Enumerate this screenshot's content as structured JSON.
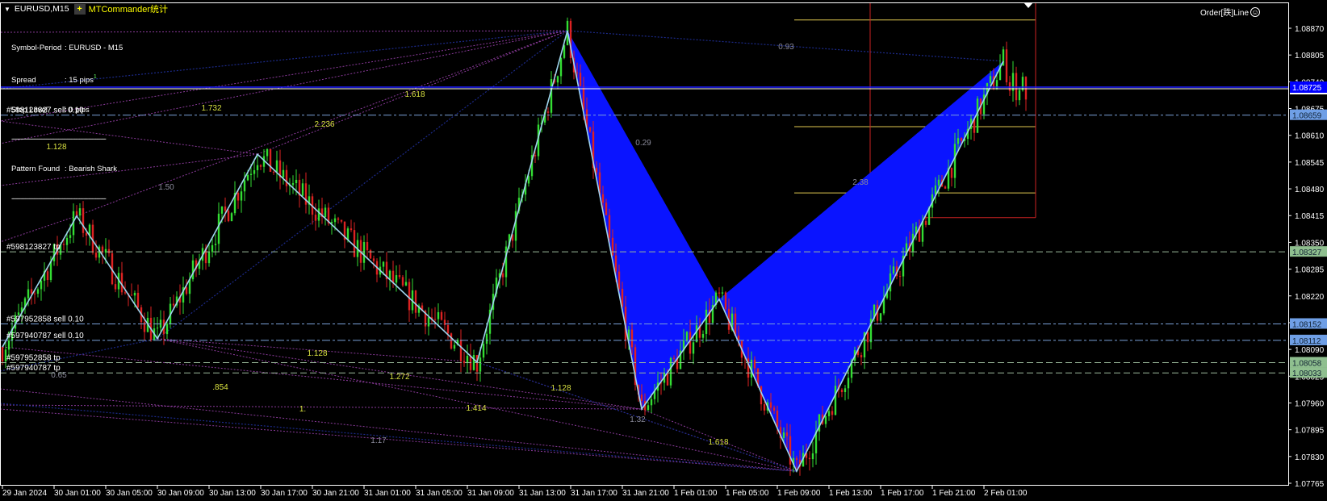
{
  "window": {
    "symbol_title": "EURUSD,M15",
    "add_button": "+",
    "indicator_title": "MTCommander统计",
    "order_line_label": "Order[跌]Line",
    "smiley": "☺"
  },
  "info_panel": {
    "symbol_period_key": "Symbol-Period",
    "symbol_period_val": ": EURUSD - M15",
    "spread_key": "Spread",
    "spread_val": ": 15 pips",
    "spread_sup": "1",
    "stop_level_key": "Stop Level",
    "stop_level_val": ": 0 pips",
    "separator": "------------------------------------------------------",
    "pattern_key": "Pattern Found",
    "pattern_val": ": Bearish Shark"
  },
  "current_price": {
    "price": 1.08725,
    "label": "1.08725"
  },
  "orders": [
    {
      "label": "#598123827 sell 0.10",
      "price": 1.08659,
      "price_label": "1.08659",
      "kind": "sell"
    },
    {
      "label": "#598123827 tp",
      "price": 1.08327,
      "price_label": "1.08327",
      "kind": "tp"
    },
    {
      "label": "#597952858 sell 0.10",
      "price": 1.08152,
      "price_label": "1.08152",
      "kind": "sell"
    },
    {
      "label": "#597940787 sell 0.10",
      "price": 1.08112,
      "price_label": "1.08112",
      "kind": "sell"
    },
    {
      "label": "#597952858 tp",
      "price": 1.08058,
      "price_label": "1.08058",
      "kind": "tp"
    },
    {
      "label": "#597940787 tp",
      "price": 1.08033,
      "price_label": "1.08033",
      "kind": "tp"
    }
  ],
  "colors": {
    "background": "#000000",
    "bull": "#33dd33",
    "bear": "#dd2222",
    "zigzag": "#9fd4ee",
    "pattern_fill": "#0a14ff",
    "fib_purple": "#8a3a9a",
    "fib_navy": "#1c2a8a",
    "sell_box": "#6f9fe6",
    "tp_box": "#8fbf8f",
    "current_box": "#0000ff",
    "level_yellow": "#e0c850",
    "rect_red": "#cc2222"
  },
  "chart_data": {
    "type": "candlestick",
    "symbol": "EURUSD",
    "timeframe": "M15",
    "pattern": "Bearish Shark",
    "ylim": [
      1.07765,
      1.0889
    ],
    "price_ticks": [
      "1.08870",
      "1.08805",
      "1.08740",
      "1.08675",
      "1.08610",
      "1.08545",
      "1.08480",
      "1.08415",
      "1.08350",
      "1.08285",
      "1.08220",
      "1.08155",
      "1.08090",
      "1.08025",
      "1.07960",
      "1.07895",
      "1.07830",
      "1.07765"
    ],
    "time_ticks": [
      "29 Jan 2024",
      "30 Jan 01:00",
      "30 Jan 05:00",
      "30 Jan 09:00",
      "30 Jan 13:00",
      "30 Jan 17:00",
      "30 Jan 21:00",
      "31 Jan 01:00",
      "31 Jan 05:00",
      "31 Jan 09:00",
      "31 Jan 13:00",
      "31 Jan 17:00",
      "31 Jan 21:00",
      "1 Feb 01:00",
      "1 Feb 05:00",
      "1 Feb 09:00",
      "1 Feb 13:00",
      "1 Feb 17:00",
      "1 Feb 21:00",
      "2 Feb 01:00"
    ],
    "first_bar_time": "29 Jan 21:00",
    "last_bar_time": "2 Feb 04:15",
    "zigzag_pivots": [
      {
        "time": "29 Jan 21:00",
        "price": 1.08096
      },
      {
        "time": "30 Jan 02:45",
        "price": 1.08414
      },
      {
        "time": "30 Jan 09:00",
        "price": 1.08116
      },
      {
        "time": "30 Jan 16:45",
        "price": 1.08564
      },
      {
        "time": "31 Jan 09:45",
        "price": 1.08059
      },
      {
        "time": "31 Jan 16:45",
        "price": 1.08864
      },
      {
        "time": "31 Jan 22:30",
        "price": 1.07945
      },
      {
        "time": "1 Feb 04:30",
        "price": 1.08212
      },
      {
        "time": "1 Feb 10:30",
        "price": 1.07794
      },
      {
        "time": "2 Feb 02:30",
        "price": 1.0879
      }
    ],
    "yellow_levels": [
      1.0889,
      1.08631,
      1.0847
    ],
    "red_box_bottom": 1.0841,
    "ratio_labels": [
      {
        "text": "1.732",
        "color": "#d8e040"
      },
      {
        "text": "2.236",
        "color": "#d8e040"
      },
      {
        "text": "1.618",
        "color": "#d8e040"
      },
      {
        "text": "1.128",
        "color": "#d8e040"
      },
      {
        "text": "1.50",
        "color": "#8a8a9a"
      },
      {
        "text": "0.93",
        "color": "#8a8a9a"
      },
      {
        "text": "0.29",
        "color": "#8a8a9a"
      },
      {
        "text": "2.38",
        "color": "#8a8a9a"
      },
      {
        "text": "1.128",
        "color": "#d8e040"
      },
      {
        "text": "0.65",
        "color": "#8a8a9a"
      },
      {
        "text": "1.272",
        "color": "#d8e040"
      },
      {
        "text": ".854",
        "color": "#d8e040"
      },
      {
        "text": "1.128",
        "color": "#d8e040"
      },
      {
        "text": "1.",
        "color": "#d8e040"
      },
      {
        "text": "1.414",
        "color": "#d8e040"
      },
      {
        "text": "1.32",
        "color": "#8a8a9a"
      },
      {
        "text": "1.17",
        "color": "#8a8a9a"
      },
      {
        "text": "1.618",
        "color": "#d8e040"
      }
    ]
  }
}
